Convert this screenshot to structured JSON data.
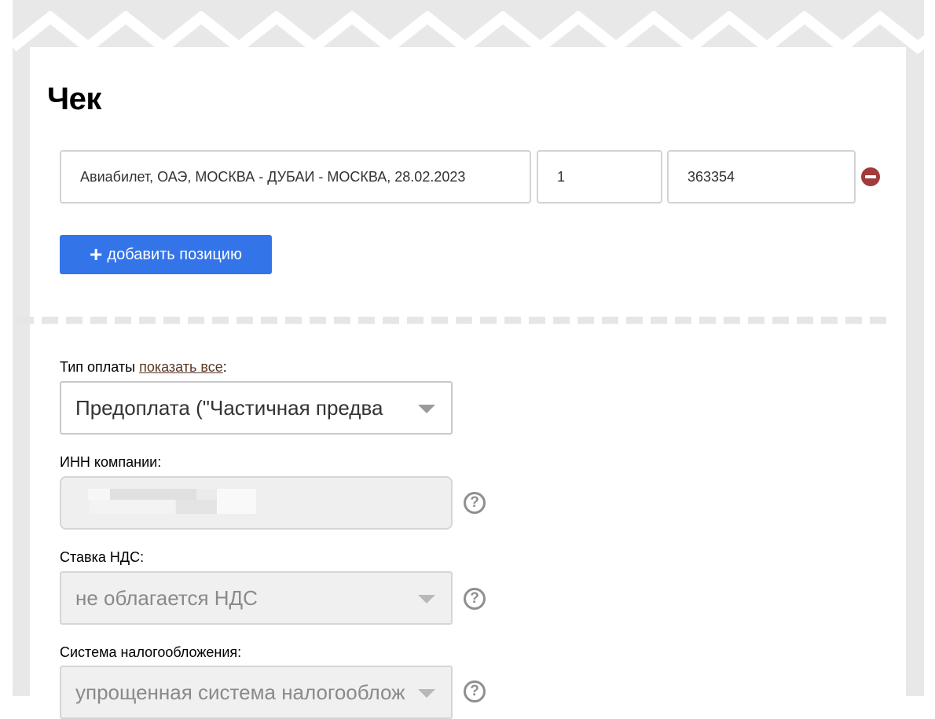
{
  "receipt": {
    "title": "Чек",
    "item": {
      "name": "Авиабилет, ОАЭ, МОСКВА - ДУБАИ - МОСКВА, 28.02.2023",
      "quantity": "1",
      "price": "363354"
    },
    "add_button_label": "добавить позицию"
  },
  "form": {
    "payment_type": {
      "label": "Тип оплаты",
      "show_all_link": "показать все",
      "suffix": ":",
      "value": "Предоплата (\"Частичная предва"
    },
    "inn": {
      "label": "ИНН компании:"
    },
    "vat": {
      "label": "Ставка НДС:",
      "value": "не облагается НДС"
    },
    "tax_system": {
      "label": "Система налогообложения:",
      "value": "упрощенная система налогообложения"
    }
  },
  "colors": {
    "accent": "#3374e8",
    "remove": "#a23b3b",
    "link": "#5a3825"
  }
}
